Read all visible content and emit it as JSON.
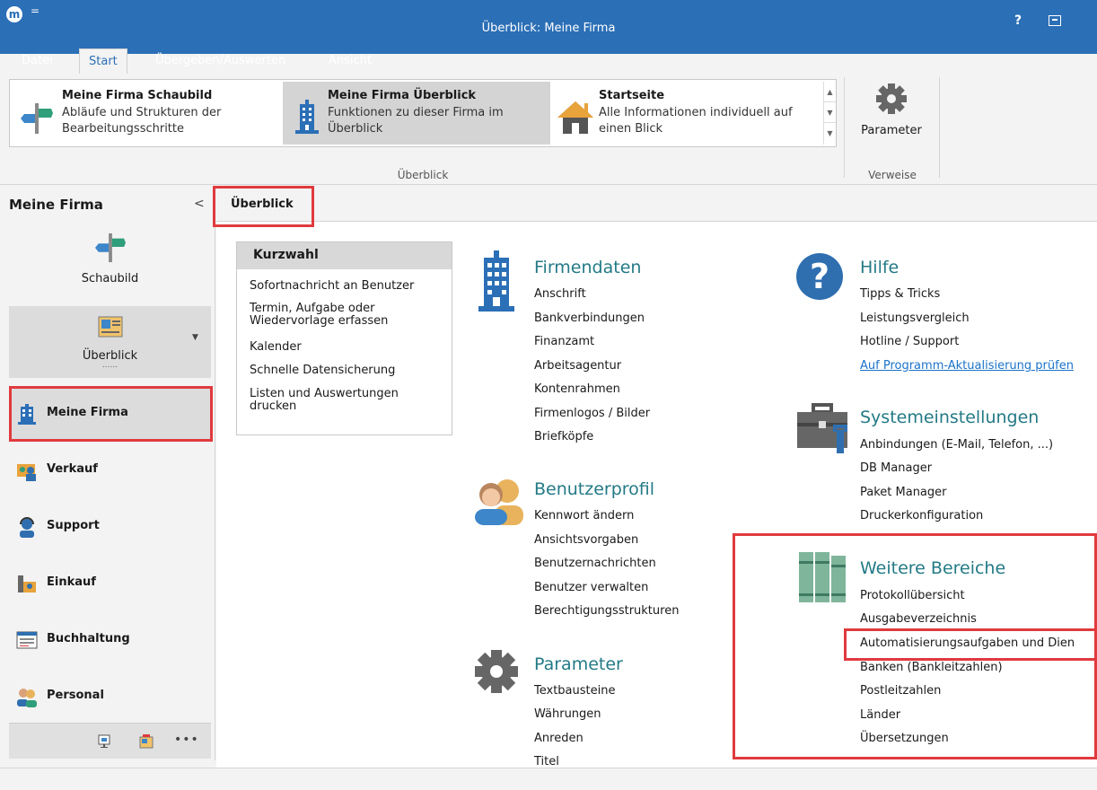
{
  "window": {
    "title": "Überblick: Meine Firma",
    "help_label": "?",
    "quick_access": "="
  },
  "tabs": [
    "Datei",
    "Start",
    "Übergeben/Auswerten",
    "Ansicht"
  ],
  "ribbon": {
    "gallery": [
      {
        "title": "Meine Firma Schaubild",
        "desc": [
          "Abläufe und Strukturen der",
          "Bearbeitungsschritte"
        ]
      },
      {
        "title": "Meine Firma Überblick",
        "desc": [
          "Funktionen zu dieser Firma im",
          "Überblick"
        ]
      },
      {
        "title": "Startseite",
        "desc": [
          "Alle Informationen individuell auf",
          "einen Blick"
        ]
      }
    ],
    "group_ueberblick": "Überblick",
    "parameter_label": "Parameter",
    "group_verweise": "Verweise"
  },
  "sidebar": {
    "title": "Meine Firma",
    "big_items": [
      "Schaubild",
      "Überblick"
    ],
    "items": [
      "Meine Firma",
      "Verkauf",
      "Support",
      "Einkauf",
      "Buchhaltung",
      "Personal"
    ],
    "more": "•••"
  },
  "main": {
    "tab_label": "Überblick",
    "kurzwahl": {
      "title": "Kurzwahl",
      "items": [
        "Sofortnachricht an Benutzer",
        "Termin, Aufgabe oder Wiedervorlage erfassen",
        "Kalender",
        "Schnelle Datensicherung",
        "Listen und Auswertungen drucken"
      ]
    },
    "firmendaten": {
      "title": "Firmendaten",
      "links": [
        "Anschrift",
        "Bankverbindungen",
        "Finanzamt",
        "Arbeitsagentur",
        "Kontenrahmen",
        "Firmenlogos / Bilder",
        "Briefköpfe"
      ]
    },
    "benutzerprofil": {
      "title": "Benutzerprofil",
      "links": [
        "Kennwort ändern",
        "Ansichtsvorgaben",
        "Benutzernachrichten",
        "Benutzer verwalten",
        "Berechtigungsstrukturen"
      ]
    },
    "parameter": {
      "title": "Parameter",
      "links": [
        "Textbausteine",
        "Währungen",
        "Anreden",
        "Titel"
      ]
    },
    "hilfe": {
      "title": "Hilfe",
      "links": [
        "Tipps & Tricks",
        "Leistungsvergleich",
        "Hotline / Support"
      ],
      "update_link": "Auf Programm-Aktualisierung prüfen"
    },
    "systemeinstellungen": {
      "title": "Systemeinstellungen",
      "links": [
        "Anbindungen (E-Mail, Telefon, ...)",
        "DB Manager",
        "Paket Manager",
        "Druckerkonfiguration"
      ]
    },
    "weitere": {
      "title": "Weitere Bereiche",
      "links": [
        "Protokollübersicht",
        "Ausgabeverzeichnis",
        "Automatisierungsaufgaben und Dien",
        "Banken (Bankleitzahlen)",
        "Postleitzahlen",
        "Länder",
        "Übersetzungen"
      ]
    }
  },
  "colors": {
    "titlebar": "#2b6fb6",
    "section": "#237a86",
    "highlight": "#e03a3e",
    "link": "#1a73c9"
  }
}
